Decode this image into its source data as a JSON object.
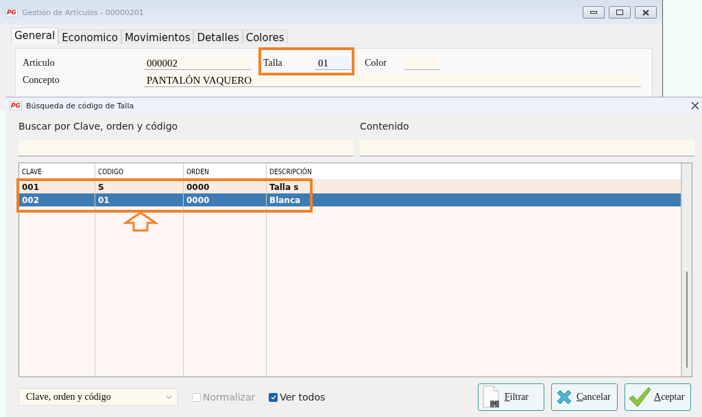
{
  "main_window": {
    "logo": "PG",
    "title": "Gestión de Artículos - 00000201",
    "tabs": [
      {
        "label": "General",
        "selected": true
      },
      {
        "label": "Economico",
        "selected": false
      },
      {
        "label": "Movimientos",
        "selected": false
      },
      {
        "label": "Detalles",
        "selected": false
      },
      {
        "label": "Colores",
        "selected": false
      }
    ],
    "fields": {
      "articulo": {
        "label": "Articulo",
        "value": "000002"
      },
      "talla": {
        "label": "Talla",
        "value": "01"
      },
      "color": {
        "label": "Color"
      },
      "concepto": {
        "label": "Concepto",
        "value": "PANTALÓN VAQUERO"
      }
    }
  },
  "dialog": {
    "logo": "PG",
    "title": "Búsqueda de código de Talla",
    "search": [
      {
        "label": "Buscar por Clave, orden y código"
      },
      {
        "label": "Contenido"
      }
    ],
    "table": {
      "columns": [
        "CLAVE",
        "CODIGO",
        "ORDEN",
        "DESCRIPCIÓN"
      ],
      "rows": [
        {
          "cells": [
            "001",
            "S",
            "0000",
            "Talla s"
          ],
          "selected": false
        },
        {
          "cells": [
            "002",
            "01",
            "0000",
            "Blanca"
          ],
          "selected": true
        }
      ]
    },
    "sort_select": {
      "value": "Clave, orden y código"
    },
    "checkboxes": [
      {
        "label": "Normalizar",
        "checked": false,
        "disabled": true
      },
      {
        "label": "Ver todos",
        "checked": true,
        "disabled": false
      }
    ],
    "buttons": [
      {
        "kind": "filter",
        "label": "Filtrar"
      },
      {
        "kind": "cancel",
        "label": "Cancelar"
      },
      {
        "kind": "accept",
        "label": "Aceptar"
      }
    ]
  }
}
